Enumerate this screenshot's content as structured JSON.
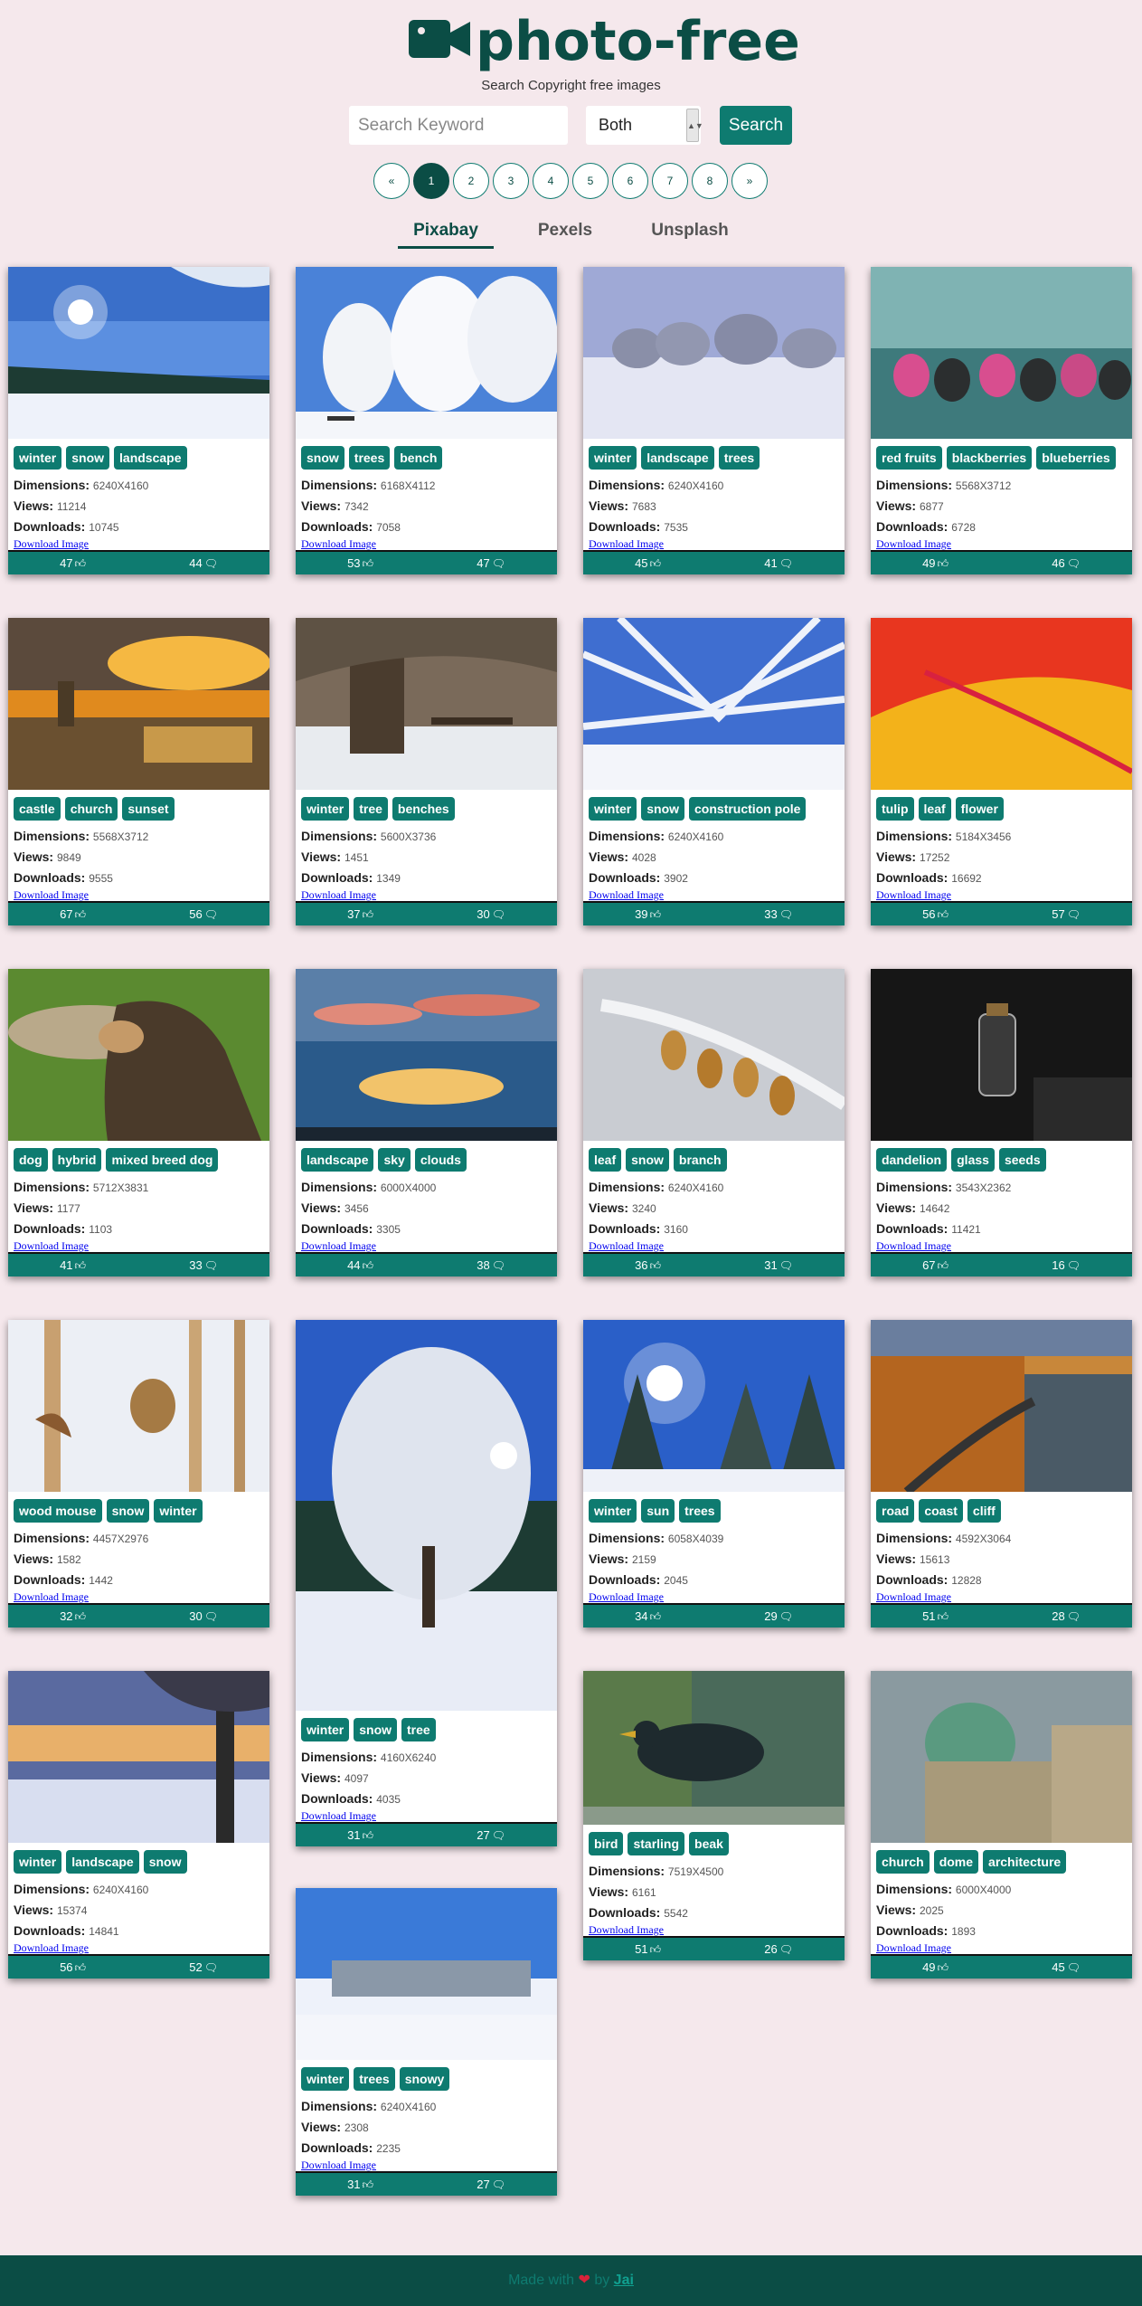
{
  "header": {
    "title": "photo-free",
    "subtitle": "Search Copyright free images",
    "search_placeholder": "Search Keyword",
    "select_value": "Both",
    "search_label": "Search"
  },
  "pagination": [
    "«",
    "1",
    "2",
    "3",
    "4",
    "5",
    "6",
    "7",
    "8",
    "»"
  ],
  "pagination_active": "1",
  "tabs": [
    "Pixabay",
    "Pexels",
    "Unsplash"
  ],
  "active_tab": "Pixabay",
  "labels": {
    "dimensions": "Dimensions:",
    "views": "Views:",
    "downloads": "Downloads:",
    "download": "Download Image"
  },
  "cards": [
    {
      "tags": [
        "winter",
        "snow",
        "landscape"
      ],
      "dimensions": "6240X4160",
      "views": "11214",
      "downloads": "10745",
      "likes": "47",
      "comments": "44",
      "scene": "winter-forest-sun"
    },
    {
      "tags": [
        "snow",
        "trees",
        "bench"
      ],
      "dimensions": "6168X4112",
      "views": "7342",
      "downloads": "7058",
      "likes": "53",
      "comments": "47",
      "scene": "frosted-trees"
    },
    {
      "tags": [
        "winter",
        "landscape",
        "trees"
      ],
      "dimensions": "6240X4160",
      "views": "7683",
      "downloads": "7535",
      "likes": "45",
      "comments": "41",
      "scene": "pale-winter"
    },
    {
      "tags": [
        "red fruits",
        "blackberries",
        "blueberries"
      ],
      "dimensions": "5568X3712",
      "views": "6877",
      "downloads": "6728",
      "likes": "49",
      "comments": "46",
      "scene": "berries"
    },
    {
      "tags": [
        "castle",
        "church",
        "sunset"
      ],
      "dimensions": "5568X3712",
      "views": "9849",
      "downloads": "9555",
      "likes": "67",
      "comments": "56",
      "scene": "castle-sunset"
    },
    {
      "tags": [
        "winter",
        "tree",
        "benches"
      ],
      "dimensions": "5600X3736",
      "views": "1451",
      "downloads": "1349",
      "likes": "37",
      "comments": "30",
      "scene": "big-tree"
    },
    {
      "tags": [
        "winter",
        "snow",
        "construction pole"
      ],
      "dimensions": "6240X4160",
      "views": "4028",
      "downloads": "3902",
      "likes": "39",
      "comments": "33",
      "scene": "frost-branches"
    },
    {
      "tags": [
        "tulip",
        "leaf",
        "flower"
      ],
      "dimensions": "5184X3456",
      "views": "17252",
      "downloads": "16692",
      "likes": "56",
      "comments": "57",
      "scene": "tulip"
    },
    {
      "tags": [
        "dog",
        "hybrid",
        "mixed breed dog"
      ],
      "dimensions": "5712X3831",
      "views": "1177",
      "downloads": "1103",
      "likes": "41",
      "comments": "33",
      "scene": "dog"
    },
    {
      "tags": [
        "landscape",
        "sky",
        "clouds"
      ],
      "dimensions": "6000X4000",
      "views": "3456",
      "downloads": "3305",
      "likes": "44",
      "comments": "38",
      "scene": "sky-clouds"
    },
    {
      "tags": [
        "leaf",
        "snow",
        "branch"
      ],
      "dimensions": "6240X4160",
      "views": "3240",
      "downloads": "3160",
      "likes": "36",
      "comments": "31",
      "scene": "snow-leaves"
    },
    {
      "tags": [
        "dandelion",
        "glass",
        "seeds"
      ],
      "dimensions": "3543X2362",
      "views": "14642",
      "downloads": "11421",
      "likes": "67",
      "comments": "16",
      "scene": "glass-bottle"
    },
    {
      "tags": [
        "wood mouse",
        "snow",
        "winter"
      ],
      "dimensions": "4457X2976",
      "views": "1582",
      "downloads": "1442",
      "likes": "32",
      "comments": "30",
      "scene": "mouse"
    },
    {
      "tags": [
        "winter",
        "snow",
        "tree"
      ],
      "dimensions": "4160X6240",
      "views": "4097",
      "downloads": "4035",
      "likes": "31",
      "comments": "27",
      "scene": "tall-tree"
    },
    {
      "tags": [
        "winter",
        "sun",
        "trees"
      ],
      "dimensions": "6058X4039",
      "views": "2159",
      "downloads": "2045",
      "likes": "34",
      "comments": "29",
      "scene": "sun-firs"
    },
    {
      "tags": [
        "road",
        "coast",
        "cliff"
      ],
      "dimensions": "4592X3064",
      "views": "15613",
      "downloads": "12828",
      "likes": "51",
      "comments": "28",
      "scene": "coast-road"
    },
    {
      "tags": [
        "winter",
        "landscape",
        "snow"
      ],
      "dimensions": "6240X4160",
      "views": "15374",
      "downloads": "14841",
      "likes": "56",
      "comments": "52",
      "scene": "winter-dusk"
    },
    {
      "tags": [
        "bird",
        "starling",
        "beak"
      ],
      "dimensions": "7519X4500",
      "views": "6161",
      "downloads": "5542",
      "likes": "51",
      "comments": "26",
      "scene": "starling"
    },
    {
      "tags": [
        "church",
        "dome",
        "architecture"
      ],
      "dimensions": "6000X4000",
      "views": "2025",
      "downloads": "1893",
      "likes": "49",
      "comments": "45",
      "scene": "dome"
    },
    {
      "tags": [
        "winter",
        "trees",
        "snowy"
      ],
      "dimensions": "6240X4160",
      "views": "2308",
      "downloads": "2235",
      "likes": "31",
      "comments": "27",
      "scene": "snowy-forest"
    }
  ],
  "footer": {
    "text": "Made with",
    "by": "by",
    "author": "Jai"
  },
  "colors": {
    "primary": "#0e7b70",
    "dark": "#0b4d45",
    "background": "#f5e8ec"
  }
}
